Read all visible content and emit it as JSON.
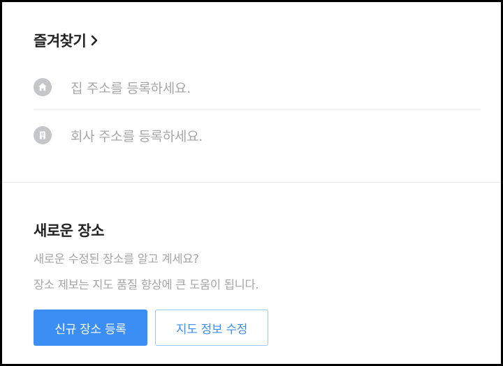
{
  "favorites": {
    "title": "즐겨찾기",
    "chevron_icon": "chevron-right-icon",
    "items": [
      {
        "label": "집 주소를 등록하세요.",
        "icon": "home-icon"
      },
      {
        "label": "회사 주소를 등록하세요.",
        "icon": "building-icon"
      }
    ]
  },
  "new_place": {
    "title": "새로운 장소",
    "description_line1": "새로운 수정된 장소를 알고 계세요?",
    "description_line2": "장소 제보는 지도 품질 향상에 큰 도움이 됩니다.",
    "register_button": "신규 장소 등록",
    "edit_button": "지도 정보 수정"
  },
  "colors": {
    "accent": "#3b8ef4",
    "title_text": "#222222",
    "placeholder_text": "#a7a7a7",
    "icon_background": "#c5c6c9"
  }
}
